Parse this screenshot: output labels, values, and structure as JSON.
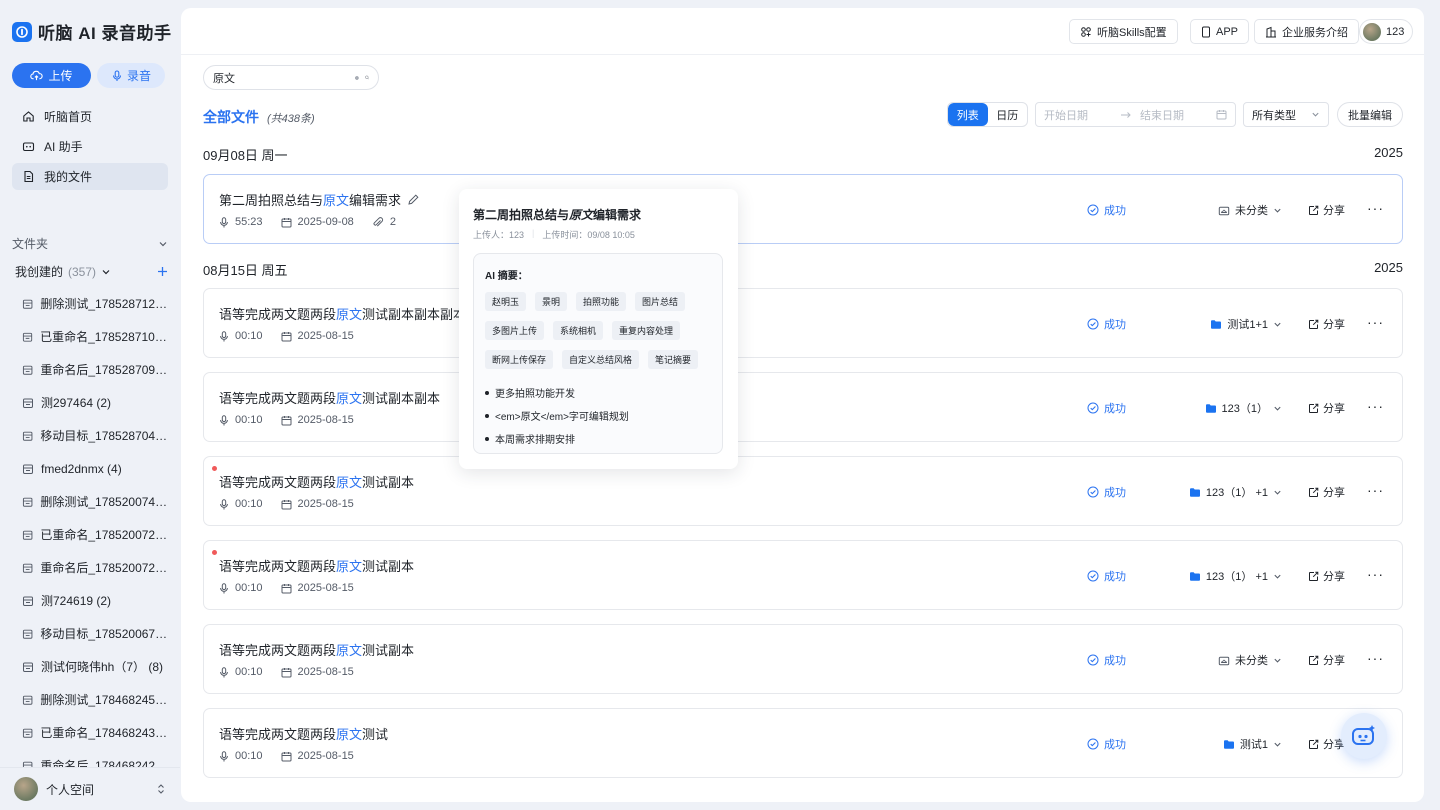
{
  "brand": {
    "title": "听脑 AI 录音助手"
  },
  "sidebar": {
    "upload_label": "上传",
    "record_label": "录音",
    "nav": [
      {
        "label": "听脑首页",
        "icon": "home-icon"
      },
      {
        "label": "AI 助手",
        "icon": "robot-icon"
      },
      {
        "label": "我的文件",
        "icon": "file-icon",
        "active": true
      }
    ],
    "folders_label": "文件夹",
    "created_label": "我创建的",
    "created_count": "(357)",
    "folders": [
      "删除测试_1785287120 ...",
      "已重命名_1785287107 (...",
      "重命名后_1785287096 ...",
      "测297464 (2)",
      "移动目标_1785287046 ...",
      "fmed2dnmx (4)",
      "删除测试_1785200743 ...",
      "已重命名_1785200729 ...",
      "重命名后_1785200720 ...",
      "测724619 (2)",
      "移动目标_1785200673 ...",
      "测试何晓伟hh（7） (8)",
      "删除测试_1784682455 ...",
      "已重命名_1784682438 ...",
      "重命名后_1784682426 ..."
    ],
    "space_label": "个人空间"
  },
  "topbar": {
    "skills_label": "听脑Skills配置",
    "app_label": "APP",
    "enterprise_label": "企业服务介绍",
    "user_name": "123"
  },
  "search": {
    "value": "原文"
  },
  "list_header": {
    "title": "全部文件",
    "count": "(共438条)",
    "view_list": "列表",
    "view_calendar": "日历",
    "start_placeholder": "开始日期",
    "end_placeholder": "结束日期",
    "type_select": "所有类型",
    "batch_edit": "批量编辑"
  },
  "groups": [
    {
      "date": "09月08日 周一",
      "year": "2025"
    },
    {
      "date": "08月15日 周五",
      "year": "2025"
    }
  ],
  "files": [
    {
      "title_pre": "第二周拍照总结与",
      "keyword": "原文",
      "title_post": "编辑需求",
      "duration": "55:23",
      "date": "2025-09-08",
      "attachments": "2",
      "status": "成功",
      "folder": "未分类",
      "folder_icon": "cloud-folder-icon",
      "share": "分享",
      "unread": false
    },
    {
      "title_pre": "语等完成两文题两段",
      "keyword": "原文",
      "title_post": "测试副本副本副本",
      "duration": "00:10",
      "date": "2025-08-15",
      "status": "成功",
      "folder": "测试1+1",
      "folder_icon": "folder-icon",
      "share": "分享",
      "unread": false
    },
    {
      "title_pre": "语等完成两文题两段",
      "keyword": "原文",
      "title_post": "测试副本副本",
      "duration": "00:10",
      "date": "2025-08-15",
      "status": "成功",
      "folder": "123（1）",
      "folder_icon": "folder-icon",
      "share": "分享",
      "unread": false
    },
    {
      "title_pre": "语等完成两文题两段",
      "keyword": "原文",
      "title_post": "测试副本",
      "duration": "00:10",
      "date": "2025-08-15",
      "status": "成功",
      "folder": "123（1） +1",
      "folder_icon": "folder-icon",
      "share": "分享",
      "unread": true
    },
    {
      "title_pre": "语等完成两文题两段",
      "keyword": "原文",
      "title_post": "测试副本",
      "duration": "00:10",
      "date": "2025-08-15",
      "status": "成功",
      "folder": "123（1） +1",
      "folder_icon": "folder-icon",
      "share": "分享",
      "unread": true
    },
    {
      "title_pre": "语等完成两文题两段",
      "keyword": "原文",
      "title_post": "测试副本",
      "duration": "00:10",
      "date": "2025-08-15",
      "status": "成功",
      "folder": "未分类",
      "folder_icon": "cloud-folder-icon",
      "share": "分享",
      "unread": false
    },
    {
      "title_pre": "语等完成两文题两段",
      "keyword": "原文",
      "title_post": "测试",
      "duration": "00:10",
      "date": "2025-08-15",
      "status": "成功",
      "folder": "测试1",
      "folder_icon": "folder-icon",
      "share": "分享",
      "unread": false
    }
  ],
  "popover": {
    "title_pre": "第二周拍照总结与",
    "title_kw": "原文",
    "title_post": "编辑需求",
    "uploader": "上传人：123",
    "upload_time": "上传时间：09/08 10:05",
    "summary_label": "AI 摘要：",
    "tags": [
      "赵明玉",
      "景明",
      "拍照功能",
      "图片总结",
      "多图片上传",
      "系统相机",
      "重复内容处理",
      "断网上传保存",
      "自定义总结风格",
      "笔记摘要"
    ],
    "bullets": [
      "更多拍照功能开发",
      "<em>原文</em>字可编辑规划",
      "本周需求排期安排"
    ]
  },
  "colors": {
    "accent": "#2b73f0",
    "unread": "#f05a5a"
  }
}
